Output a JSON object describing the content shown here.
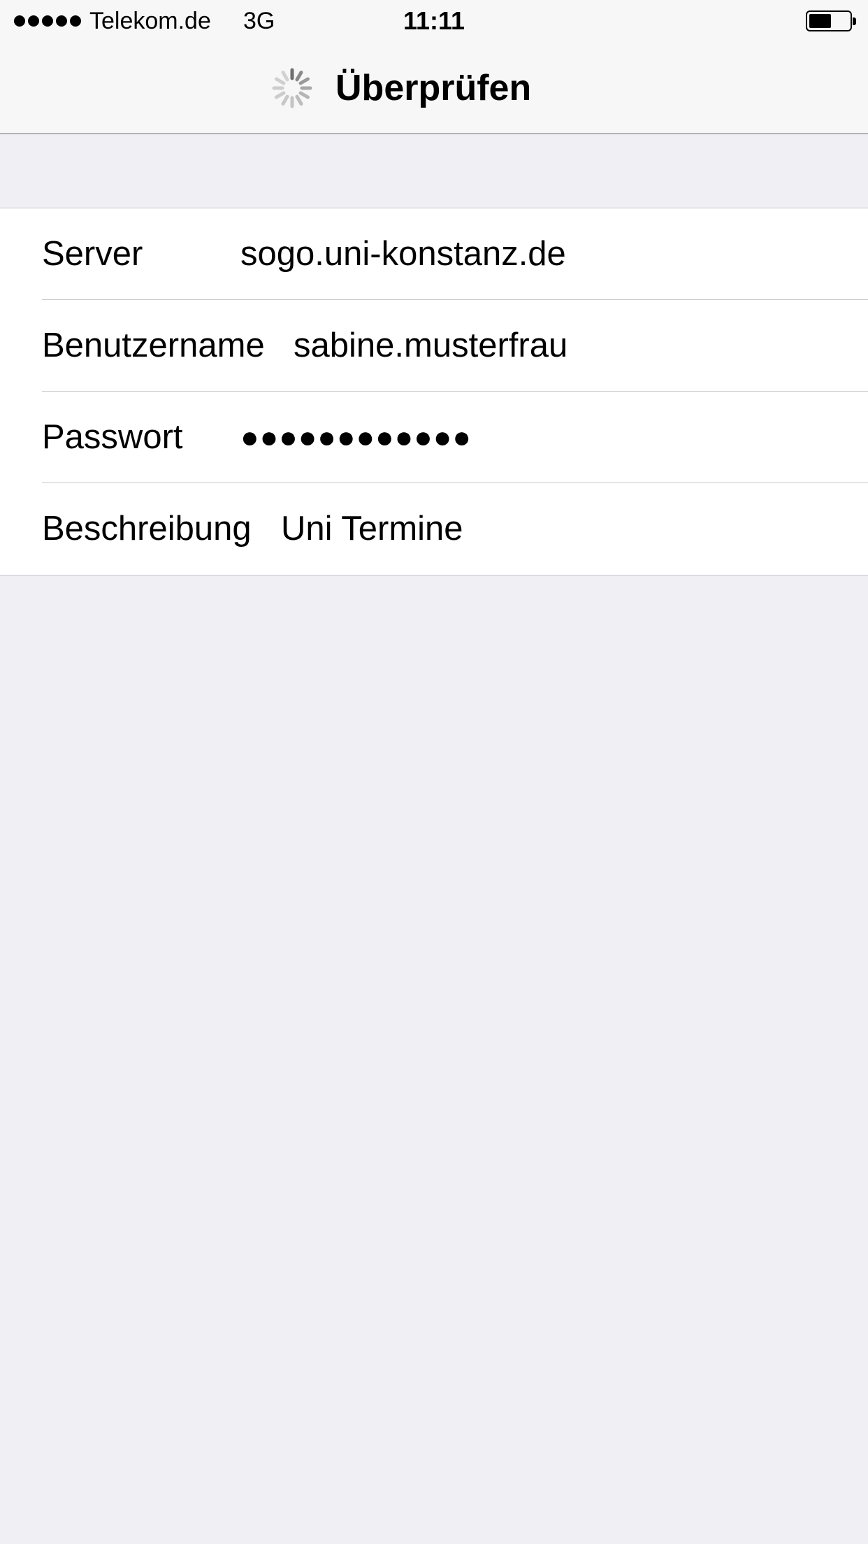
{
  "status_bar": {
    "signal_dots": "●●●●●",
    "carrier": "Telekom.de",
    "network": "3G",
    "time": "11:11",
    "battery_level": 0.55
  },
  "nav": {
    "title": "Überprüfen",
    "activity_icon": "spinner-icon"
  },
  "form": {
    "rows": [
      {
        "label": "Server",
        "value": "sogo.uni-konstanz.de"
      },
      {
        "label": "Benutzername",
        "value": "sabine.musterfrau"
      },
      {
        "label": "Passwort",
        "value": "●●●●●●●●●●●●"
      },
      {
        "label": "Beschreibung",
        "value": "Uni Termine"
      }
    ]
  },
  "colors": {
    "background": "#efeff4",
    "bar": "#f7f7f7",
    "separator": "#c8c7cc"
  }
}
